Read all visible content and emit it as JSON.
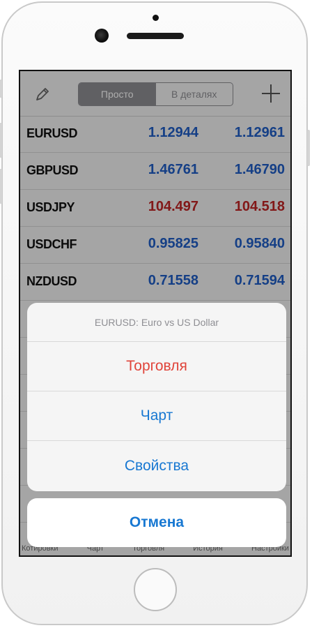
{
  "toolbar": {
    "segments": [
      {
        "label": "Просто",
        "active": true
      },
      {
        "label": "В деталях",
        "active": false
      }
    ]
  },
  "quotes": [
    {
      "symbol": "EURUSD",
      "bid": "1.12944",
      "ask": "1.12961",
      "color": "#1f5ec6"
    },
    {
      "symbol": "GBPUSD",
      "bid": "1.46761",
      "ask": "1.46790",
      "color": "#1f5ec6"
    },
    {
      "symbol": "USDJPY",
      "bid": "104.497",
      "ask": "104.518",
      "color": "#c02424"
    },
    {
      "symbol": "USDCHF",
      "bid": "0.95825",
      "ask": "0.95840",
      "color": "#1f5ec6"
    },
    {
      "symbol": "NZDUSD",
      "bid": "0.71558",
      "ask": "0.71594",
      "color": "#1f5ec6"
    }
  ],
  "tabbar": {
    "items": [
      "Котировки",
      "Чарт",
      "Торговля",
      "История",
      "Настройки"
    ]
  },
  "action_sheet": {
    "title": "EURUSD: Euro vs US Dollar",
    "actions": [
      {
        "label": "Торговля",
        "style": "destructive"
      },
      {
        "label": "Чарт",
        "style": "default"
      },
      {
        "label": "Свойства",
        "style": "default"
      }
    ],
    "cancel_label": "Отмена"
  },
  "colors": {
    "accent": "#1878d2",
    "destructive": "#e0443a",
    "price_up": "#1f5ec6",
    "price_down": "#c02424"
  },
  "icons": [
    "edit-icon",
    "plus-icon"
  ]
}
